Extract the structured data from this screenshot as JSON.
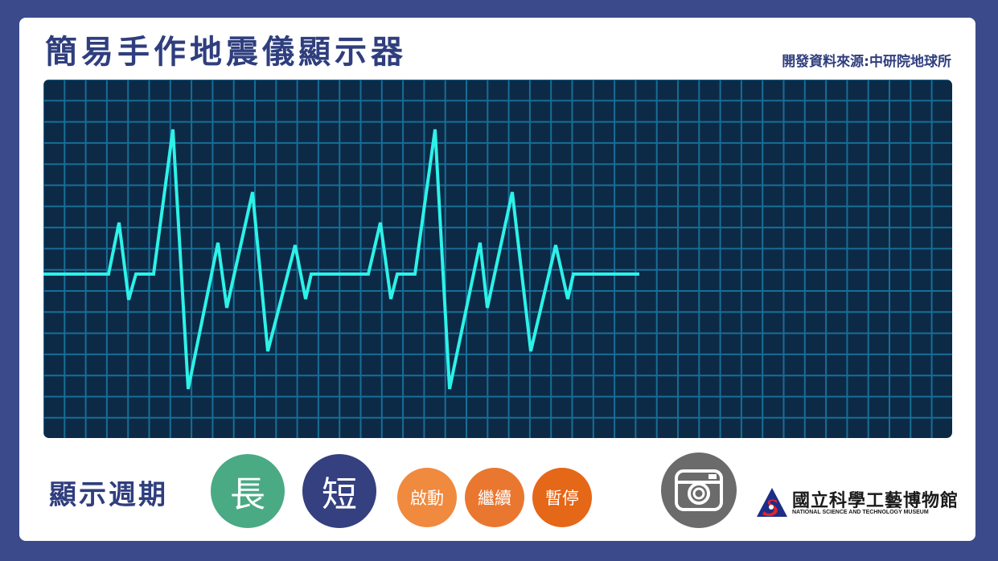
{
  "header": {
    "title": "簡易手作地震儀顯示器",
    "source": "開發資料來源:中研院地球所"
  },
  "controls": {
    "period_label": "顯示週期",
    "long_label": "長",
    "short_label": "短",
    "start_label": "啟動",
    "continue_label": "繼續",
    "pause_label": "暫停",
    "camera_icon": "camera-icon"
  },
  "logo": {
    "name_cn": "國立科學工藝博物館",
    "name_en": "NATIONAL SCIENCE AND TECHNOLOGY MUSEUM"
  },
  "colors": {
    "background": "#3b4a8a",
    "screen": "#0c2a46",
    "grid": "#1a7aa4",
    "trace": "#2df2e8",
    "long": "#4aaa84",
    "short": "#34407f",
    "start": "#f08a3e",
    "continue": "#ea7730",
    "pause": "#e56718",
    "camera": "#6b6b6b"
  }
}
